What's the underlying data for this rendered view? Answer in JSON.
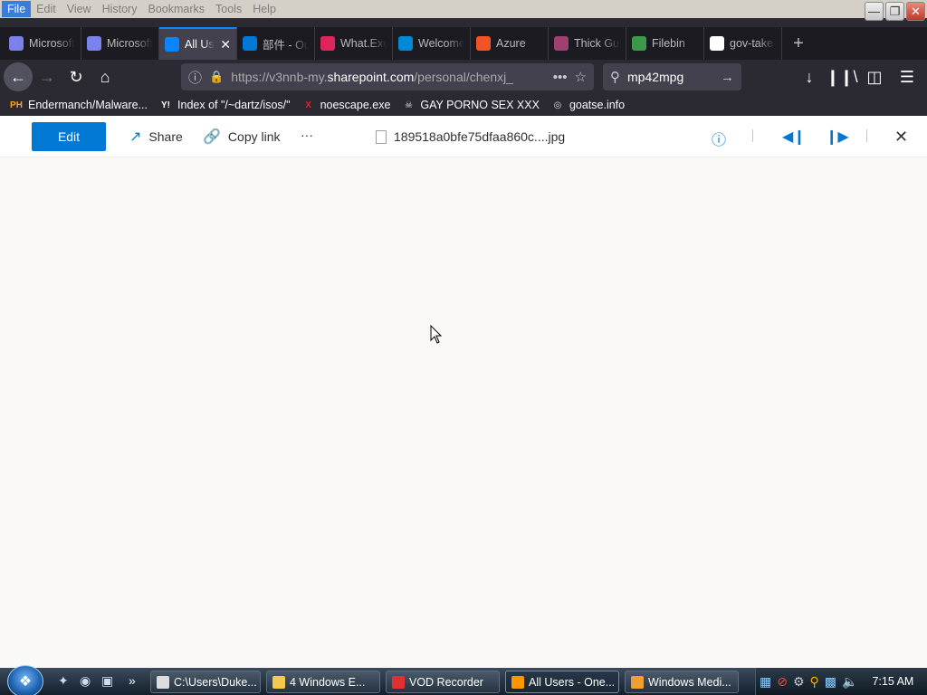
{
  "menubar": {
    "items": [
      "File",
      "Edit",
      "View",
      "History",
      "Bookmarks",
      "Tools",
      "Help"
    ]
  },
  "tabs": [
    {
      "label": "Microsoft",
      "icon": "ms-teams-icon",
      "color": "#7b83eb"
    },
    {
      "label": "Microsoft",
      "icon": "ms-teams-icon",
      "color": "#7b83eb"
    },
    {
      "label": "All Users",
      "icon": "onedrive-icon",
      "color": "#0a84ff",
      "active": true
    },
    {
      "label": "部件 - Outlook",
      "icon": "outlook-icon",
      "color": "#0078d4"
    },
    {
      "label": "What.Exe",
      "icon": "play-icon",
      "color": "#e0245e"
    },
    {
      "label": "Welcome",
      "icon": "azure-icon",
      "color": "#0089d6"
    },
    {
      "label": "Azure",
      "icon": "windows-icon",
      "color": "#f35325"
    },
    {
      "label": "Thick Guy",
      "icon": "thickguy-icon",
      "color": "#a04070"
    },
    {
      "label": "Filebin",
      "icon": "filebin-icon",
      "color": "#3a9a4a"
    },
    {
      "label": "gov-take",
      "icon": "github-icon",
      "color": "#ffffff"
    }
  ],
  "navbar": {
    "url_prefix": "https://v3nnb-my.",
    "url_domain": "sharepoint.com",
    "url_suffix": "/personal/chenxj_",
    "search_value": "mp42mpg"
  },
  "bookmarks": [
    {
      "label": "Endermanch/Malware...",
      "icon": "PH",
      "color": "#f5a623"
    },
    {
      "label": "Index of \"/~dartz/isos/\"",
      "icon": "Y!",
      "color": "#ffffff"
    },
    {
      "label": "noescape.exe",
      "icon": "X",
      "color": "#e0202a"
    },
    {
      "label": "GAY PORNO SEX XXX",
      "icon": "☠",
      "color": "#dddddd"
    },
    {
      "label": "goatse.info",
      "icon": "◎",
      "color": "#dddddd"
    }
  ],
  "viewer": {
    "edit_label": "Edit",
    "share_label": "Share",
    "copy_link_label": "Copy link",
    "more_label": "···",
    "filename": "189518a0bfe75dfaa860c....jpg"
  },
  "taskbar": {
    "buttons": [
      {
        "label": "C:\\Users\\Duke...",
        "icon": "cmd-icon",
        "color": "#dddddd"
      },
      {
        "label": "4 Windows E...",
        "icon": "folder-icon",
        "color": "#f2c94c"
      },
      {
        "label": "VOD Recorder",
        "icon": "record-icon",
        "color": "#e03030"
      },
      {
        "label": "All Users - One...",
        "icon": "firefox-icon",
        "color": "#ff9500",
        "active": true
      },
      {
        "label": "Windows Medi...",
        "icon": "wmp-icon",
        "color": "#f0a030"
      }
    ],
    "clock": "7:15 AM"
  }
}
